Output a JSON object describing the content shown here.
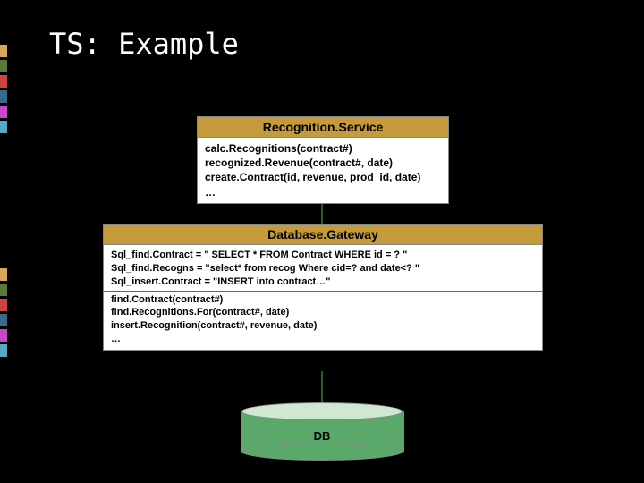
{
  "title": "TS: Example",
  "classes": [
    {
      "name": "Recognition.Service",
      "methods": [
        "calc.Recognitions(contract#)",
        "recognized.Revenue(contract#, date)",
        "create.Contract(id, revenue, prod_id, date)",
        "…"
      ]
    },
    {
      "name": "Database.Gateway",
      "fields": [
        "Sql_find.Contract = \" SELECT * FROM Contract WHERE id = ? \"",
        "Sql_find.Recogns = \"select* from recog Where cid=? and date<? \"",
        "Sql_insert.Contract = \"INSERT into contract…\""
      ],
      "methods": [
        "find.Contract(contract#)",
        "find.Recognitions.For(contract#, date)",
        "insert.Recognition(contract#, revenue, date)",
        "…"
      ]
    }
  ],
  "database": {
    "label": "DB"
  }
}
